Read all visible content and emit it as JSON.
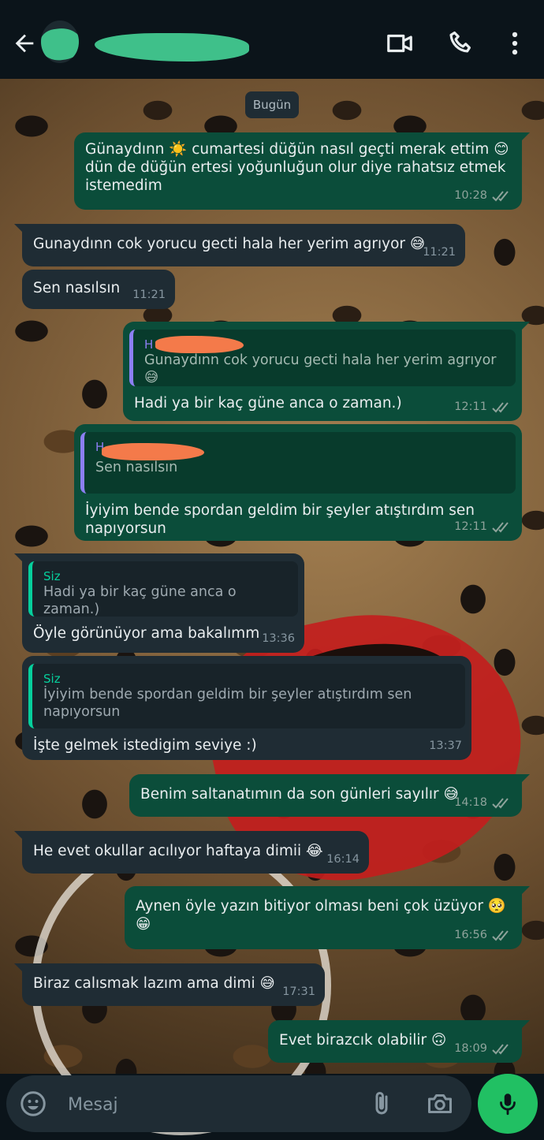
{
  "header": {
    "contact_name": "",
    "icons": [
      "back-arrow-icon",
      "video-call-icon",
      "phone-icon",
      "more-vertical-icon"
    ]
  },
  "chat": {
    "date_chip": "Bugün",
    "messages": [
      {
        "dir": "out",
        "lines": [
          "Günaydınn ☀️ cumartesi düğün nasıl geçti merak ettim 😊",
          "dün de düğün ertesi yoğunluğun olur diye rahatsız etmek",
          "istemedim"
        ],
        "time": "10:28"
      },
      {
        "dir": "in",
        "text": "Gunaydınn cok yorucu gecti hala her yerim agrıyor 😅",
        "time": "11:21"
      },
      {
        "dir": "in",
        "text": "Sen nasılsın",
        "time": "11:21"
      },
      {
        "dir": "out",
        "quote_author": "H",
        "quote_text": "Gunaydınn cok yorucu gecti hala her yerim agrıyor 😅",
        "text": "Hadi ya bir kaç güne anca o zaman.)",
        "time": "12:11"
      },
      {
        "dir": "out",
        "quote_author": "H",
        "quote_text": "Sen nasılsın",
        "lines": [
          "İyiyim bende spordan geldim bir şeyler atıştırdım sen",
          "napıyorsun"
        ],
        "time": "12:11"
      },
      {
        "dir": "in",
        "quote_author": "Siz",
        "quote_text": "Hadi ya bir kaç güne anca o zaman.)",
        "text": "Öyle görünüyor ama bakalımm",
        "time": "13:36"
      },
      {
        "dir": "in",
        "quote_author": "Siz",
        "quote_lines": [
          "İyiyim bende spordan geldim bir şeyler atıştırdım sen",
          "napıyorsun"
        ],
        "text": "İşte gelmek istedigim seviye :)",
        "time": "13:37"
      },
      {
        "dir": "out",
        "text": "Benim saltanatımın da son günleri sayılır 😅",
        "time": "14:18"
      },
      {
        "dir": "in",
        "text": "He evet okullar acılıyor haftaya dimii 😂",
        "time": "16:14"
      },
      {
        "dir": "out",
        "text": "Aynen öyle yazın bitiyor olması beni çok üzüyor 🥺😁",
        "time": "16:56"
      },
      {
        "dir": "in",
        "text": "Biraz calısmak lazım ama dimi 😅",
        "time": "17:31"
      },
      {
        "dir": "out",
        "text": "Evet birazcık olabilir 🙃",
        "time": "18:09"
      }
    ]
  },
  "input": {
    "placeholder": "Mesaj",
    "value": ""
  },
  "colors": {
    "outgoing_bubble": "#0b4d3a",
    "incoming_bubble": "#1f2c34",
    "accent_green": "#21c063"
  }
}
